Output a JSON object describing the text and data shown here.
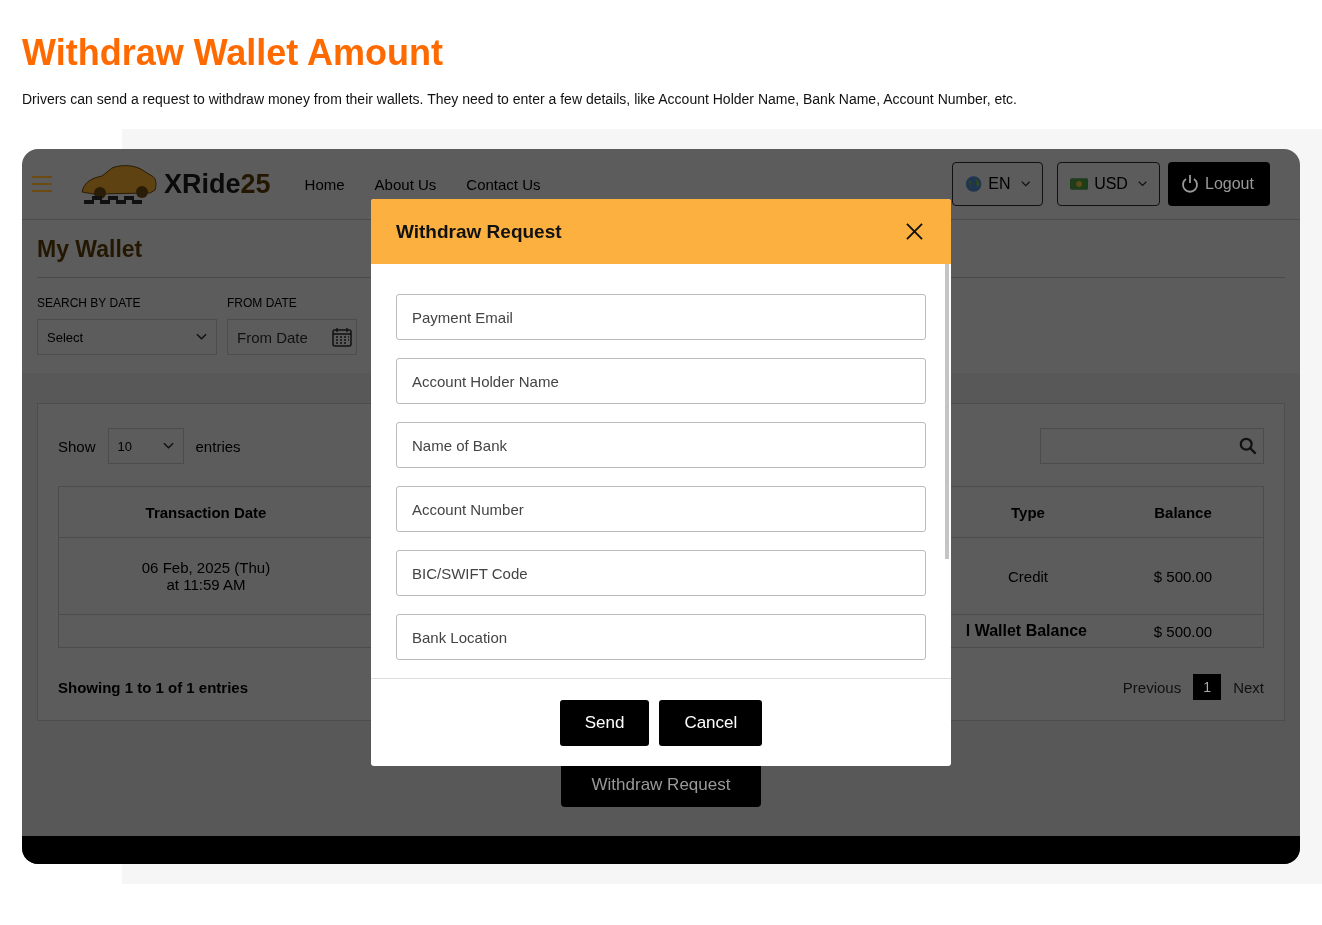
{
  "page": {
    "title": "Withdraw Wallet Amount",
    "description": "Drivers can send a request to withdraw money from their wallets. They need to enter a few details, like Account Holder Name, Bank Name, Account Number, etc."
  },
  "navbar": {
    "brand": "XRide",
    "brand_suffix": "25",
    "links": [
      "Home",
      "About Us",
      "Contact Us"
    ],
    "language": "EN",
    "currency": "USD",
    "logout": "Logout"
  },
  "wallet": {
    "title": "My Wallet",
    "filters": [
      {
        "label": "SEARCH BY DATE",
        "kind": "select",
        "value": "Select"
      },
      {
        "label": "FROM DATE",
        "kind": "date",
        "placeholder": "From Date"
      }
    ],
    "table": {
      "show_label": "Show",
      "page_size": "10",
      "entries_label": "entries",
      "columns": [
        "Transaction Date",
        "Type",
        "Balance"
      ],
      "rows": [
        {
          "date": "06 Feb, 2025 (Thu)",
          "time": "at 11:59 AM",
          "type": "Credit",
          "balance": "$ 500.00"
        }
      ],
      "total": {
        "label": "l Wallet Balance",
        "value": "$ 500.00"
      },
      "info": "Showing 1 to 1 of 1 entries",
      "pagination": {
        "previous": "Previous",
        "pages": [
          {
            "label": "1",
            "selected": true
          }
        ],
        "next": "Next"
      }
    },
    "action": "Withdraw Request"
  },
  "modal": {
    "title": "Withdraw Request",
    "fields": [
      {
        "placeholder": "Payment Email"
      },
      {
        "placeholder": "Account Holder Name"
      },
      {
        "placeholder": "Name of Bank"
      },
      {
        "placeholder": "Account Number"
      },
      {
        "placeholder": "BIC/SWIFT Code"
      },
      {
        "placeholder": "Bank Location"
      }
    ],
    "buttons": [
      "Send",
      "Cancel"
    ]
  }
}
